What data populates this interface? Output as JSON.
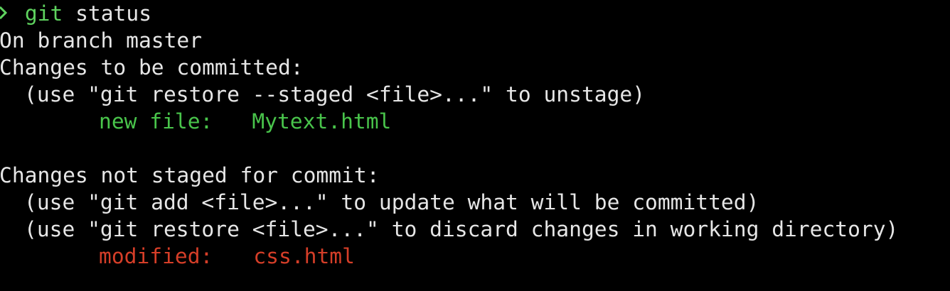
{
  "prompt": {
    "symbol_icon": "chevron-right-icon",
    "symbol_color": "#5fd35f",
    "command": "git",
    "args": "status"
  },
  "output": {
    "branch_line": "On branch master",
    "staged_header": "Changes to be committed:",
    "staged_hint": "(use \"git restore --staged <file>...\" to unstage)",
    "staged_files": [
      {
        "status": "new file:",
        "file": "Mytext.html",
        "color": "#49c44b"
      }
    ],
    "unstaged_header": "Changes not staged for commit:",
    "unstaged_hints": [
      "(use \"git add <file>...\" to update what will be committed)",
      "(use \"git restore <file>...\" to discard changes in working directory)"
    ],
    "unstaged_files": [
      {
        "status": "modified:",
        "file": "css.html",
        "color": "#d53e28"
      }
    ]
  },
  "colors": {
    "background": "#000000",
    "foreground": "#e6e6e6",
    "prompt": "#5fd35f",
    "added": "#49c44b",
    "modified": "#d53e28"
  }
}
